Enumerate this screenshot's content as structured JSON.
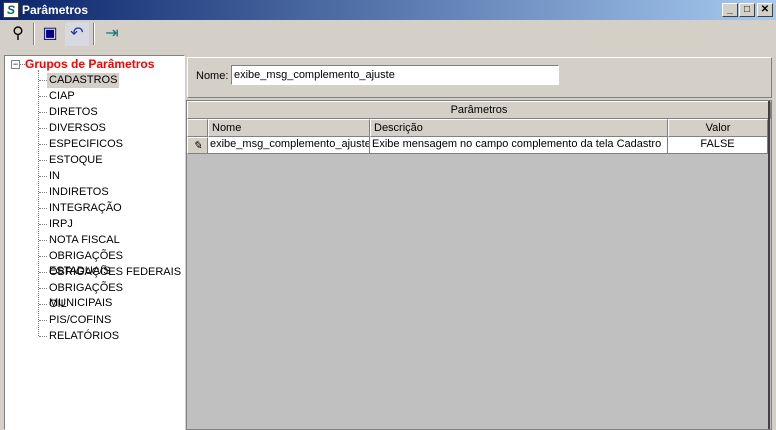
{
  "window": {
    "title": "Parâmetros",
    "icon": "S"
  },
  "toolbar": [
    {
      "name": "search-binoculars-icon",
      "glyph": "🔭"
    },
    {
      "name": "save-icon",
      "glyph": "💾"
    },
    {
      "name": "undo-icon",
      "glyph": "↶"
    },
    {
      "name": "exit-door-icon",
      "glyph": "🚪"
    }
  ],
  "tree": {
    "root": "Grupos de Parâmetros",
    "items": [
      "CADASTROS",
      "CIAP",
      "DIRETOS",
      "DIVERSOS",
      "ESPECIFICOS",
      "ESTOQUE",
      "IN",
      "INDIRETOS",
      "INTEGRAÇÃO",
      "IRPJ",
      "NOTA FISCAL",
      "OBRIGAÇÕES ESTADUAIS",
      "OBRIGAÇÕES FEDERAIS",
      "OBRIGAÇÕES MUNICIPAIS",
      "OIL",
      "PIS/COFINS",
      "RELATÓRIOS"
    ],
    "selected": "CADASTROS"
  },
  "filter": {
    "label": "Nome:",
    "value": "exibe_msg_complemento_ajuste"
  },
  "grid": {
    "title": "Parâmetros",
    "columns": [
      "Nome",
      "Descrição",
      "Valor"
    ],
    "rows": [
      [
        "exibe_msg_complemento_ajuste",
        "Exibe mensagem no campo complemento da tela Cadastro",
        "FALSE"
      ]
    ]
  }
}
